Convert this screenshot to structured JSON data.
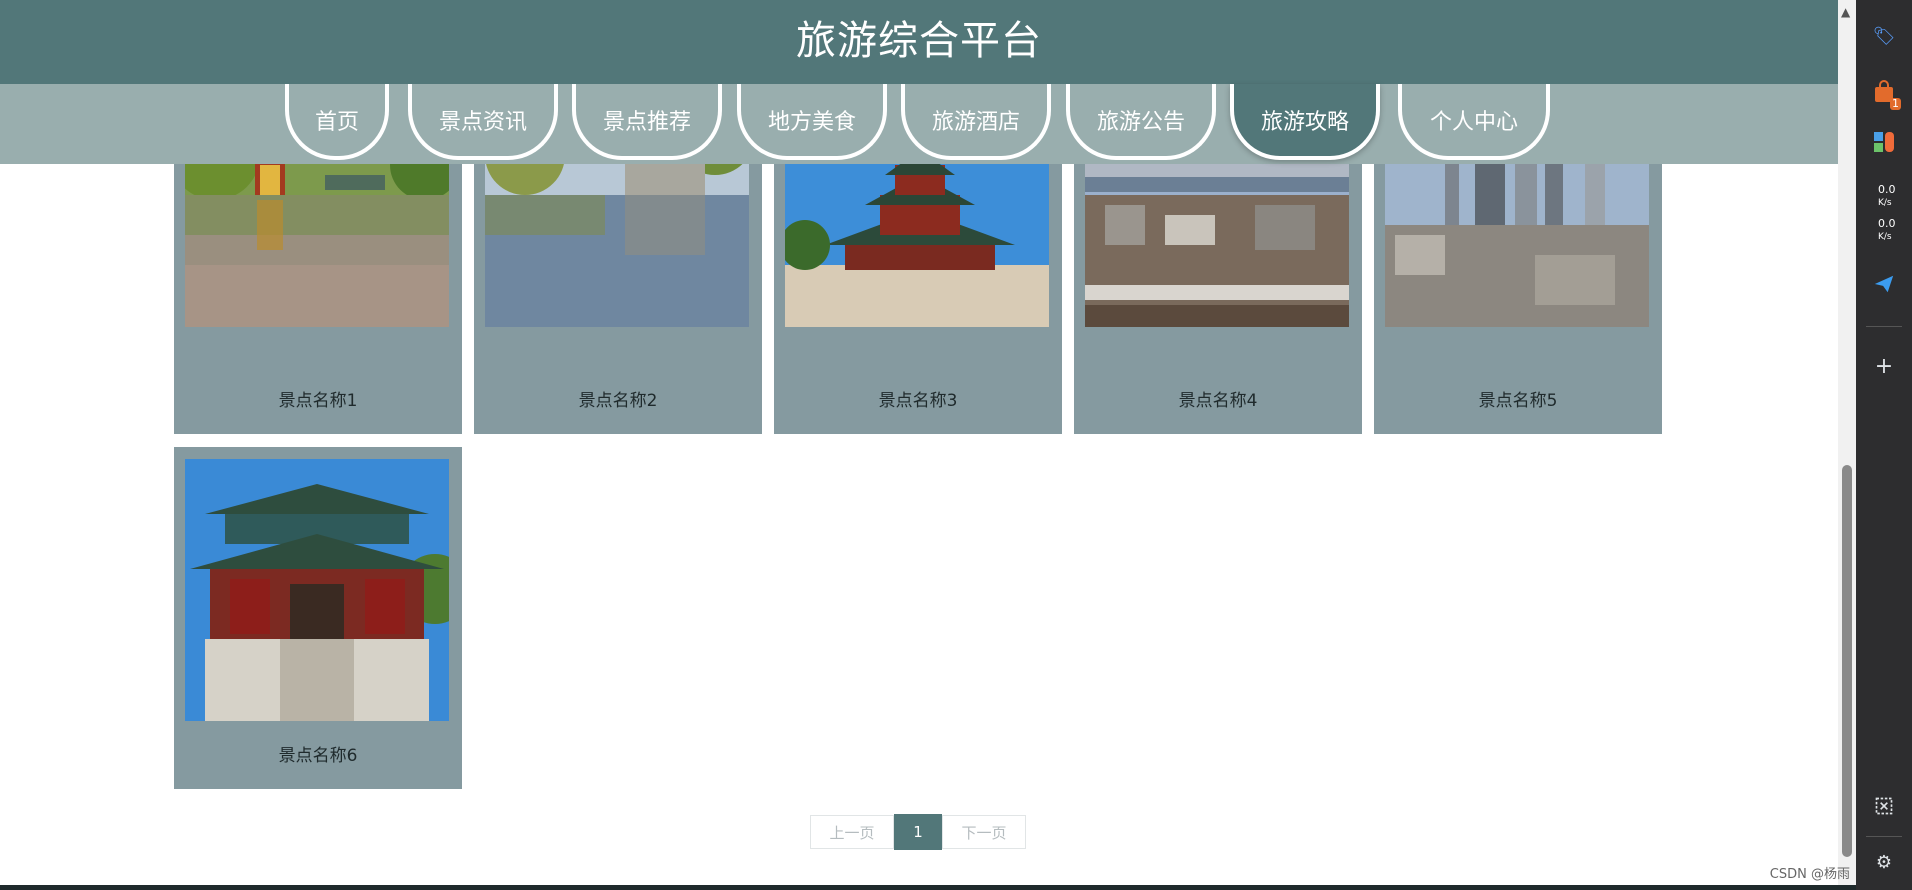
{
  "header": {
    "title": "旅游综合平台"
  },
  "nav": {
    "items": [
      {
        "label": "首页"
      },
      {
        "label": "景点资讯"
      },
      {
        "label": "景点推荐"
      },
      {
        "label": "地方美食"
      },
      {
        "label": "旅游酒店"
      },
      {
        "label": "旅游公告"
      },
      {
        "label": "旅游攻略"
      },
      {
        "label": "个人中心"
      }
    ],
    "active_label": "旅游攻略"
  },
  "attractions": [
    {
      "name": "景点名称1"
    },
    {
      "name": "景点名称2"
    },
    {
      "name": "景点名称3"
    },
    {
      "name": "景点名称4"
    },
    {
      "name": "景点名称5"
    },
    {
      "name": "景点名称6"
    }
  ],
  "pagination": {
    "prev_label": "上一页",
    "current_page": "1",
    "next_label": "下一页"
  },
  "browser_panel": {
    "upload_rate": "0.0",
    "upload_unit": "K/s",
    "download_rate": "0.0",
    "download_unit": "K/s",
    "badge_count": "1",
    "watermark": "CSDN @杨雨"
  },
  "colors": {
    "primary": "#527779",
    "nav_bg": "#99aeae",
    "card_bg": "#859aa0"
  }
}
